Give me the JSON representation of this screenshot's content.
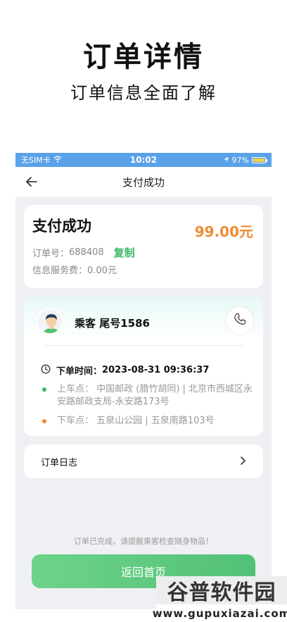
{
  "hero": {
    "title": "订单详情",
    "subtitle": "订单信息全面了解"
  },
  "status_bar": {
    "carrier": "无SIM卡",
    "time": "10:02",
    "battery": "97%",
    "battery_level": 0.97
  },
  "nav": {
    "title": "支付成功",
    "back_icon": "arrow-left-icon"
  },
  "payment": {
    "title": "支付成功",
    "amount": "99.00元",
    "order_label": "订单号：",
    "order_number": "688408",
    "copy_label": "复制",
    "fee": "信息服务费：0.00元"
  },
  "passenger": {
    "name": "乘客 尾号1586",
    "order_time_label": "下单时间：",
    "order_time": "2023-08-31 09:36:37",
    "pickup": "上车点：  中国邮政 (腊竹胡同)  |  北京市西城区永安路邮政支局-永安路173号",
    "dropoff": "下车点：  五泉山公园  |  五泉南路103号"
  },
  "log": {
    "label": "订单日志"
  },
  "footer": {
    "reminder": "订单已完成，请提醒乘客检查随身物品！",
    "home_button": "返回首页"
  },
  "watermark": {
    "top": "谷普软件园",
    "bottom": "www.gupuxiazai.com"
  },
  "colors": {
    "accent_green": "#3cb56a",
    "amount_orange": "#ef8c34",
    "status_bar": "#5aa2e8",
    "pickup_dot": "#3cb56a",
    "dropoff_dot": "#ef8c34"
  }
}
